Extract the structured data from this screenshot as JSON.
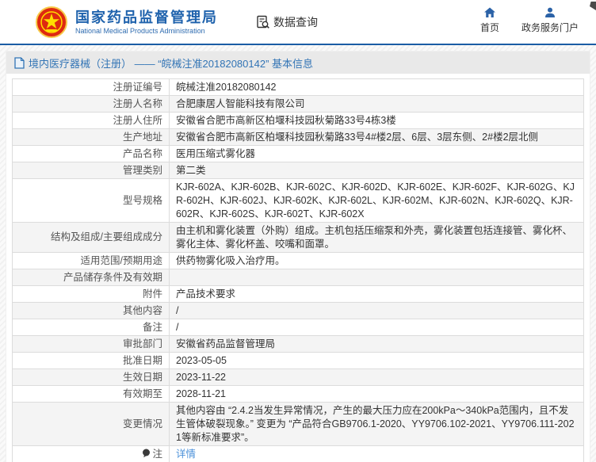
{
  "header": {
    "agency_cn": "国家药品监督管理局",
    "agency_en": "National Medical Products Administration",
    "data_query_label": "数据查询",
    "nav": {
      "home_label": "首页",
      "portal_label": "政务服务门户"
    }
  },
  "breadcrumb": {
    "text": "境内医疗器械（注册） —— “皖械注准20182080142” 基本信息"
  },
  "table": {
    "rows": [
      {
        "label": "注册证编号",
        "value": "皖械注准20182080142"
      },
      {
        "label": "注册人名称",
        "value": "合肥康居人智能科技有限公司"
      },
      {
        "label": "注册人住所",
        "value": "安徽省合肥市高新区柏堰科技园秋菊路33号4栋3楼"
      },
      {
        "label": "生产地址",
        "value": "安徽省合肥市高新区柏堰科技园秋菊路33号4#楼2层、6层、3层东侧、2#楼2层北侧"
      },
      {
        "label": "产品名称",
        "value": "医用压缩式雾化器"
      },
      {
        "label": "管理类别",
        "value": "第二类"
      },
      {
        "label": "型号规格",
        "value": "KJR-602A、KJR-602B、KJR-602C、KJR-602D、KJR-602E、KJR-602F、KJR-602G、KJR-602H、KJR-602J、KJR-602K、KJR-602L、KJR-602M、KJR-602N、KJR-602Q、KJR-602R、KJR-602S、KJR-602T、KJR-602X"
      },
      {
        "label": "结构及组成/主要组成成分",
        "value": "由主机和雾化装置（外购）组成。主机包括压缩泵和外壳，雾化装置包括连接管、雾化杯、雾化主体、雾化杯盖、咬嘴和面罩。"
      },
      {
        "label": "适用范围/预期用途",
        "value": "供药物雾化吸入治疗用。"
      },
      {
        "label": "产品储存条件及有效期",
        "value": ""
      },
      {
        "label": "附件",
        "value": "产品技术要求"
      },
      {
        "label": "其他内容",
        "value": "/"
      },
      {
        "label": "备注",
        "value": "/"
      },
      {
        "label": "审批部门",
        "value": "安徽省药品监督管理局"
      },
      {
        "label": "批准日期",
        "value": "2023-05-05"
      },
      {
        "label": "生效日期",
        "value": "2023-11-22"
      },
      {
        "label": "有效期至",
        "value": "2028-11-21"
      },
      {
        "label": "变更情况",
        "value": "其他内容由 “2.4.2当发生异常情况，产生的最大压力应在200kPa～340kPa范围内，且不发生管体破裂现象。” 变更为 “产品符合GB9706.1-2020、YY9706.102-2021、YY9706.111-2021等新标准要求”。"
      },
      {
        "label": "注",
        "value": "详情",
        "is_link": true,
        "has_icon": true
      }
    ]
  },
  "icons": {
    "emblem": "national-emblem",
    "data_query": "document-search-icon",
    "home": "home-icon",
    "portal": "user-icon",
    "breadcrumb": "document-icon",
    "note": "note-balloon-icon"
  },
  "colors": {
    "brand_blue": "#2063ad",
    "header_line": "#1b5da5",
    "breadcrumb_bg": "#e9e9e9",
    "breadcrumb_text": "#3274b5",
    "row_alt_bg": "#f4f4f4",
    "table_border": "#dcdcdc",
    "link_blue": "#4a90d9",
    "emblem_red": "#de2910",
    "emblem_gold": "#ffde00"
  }
}
